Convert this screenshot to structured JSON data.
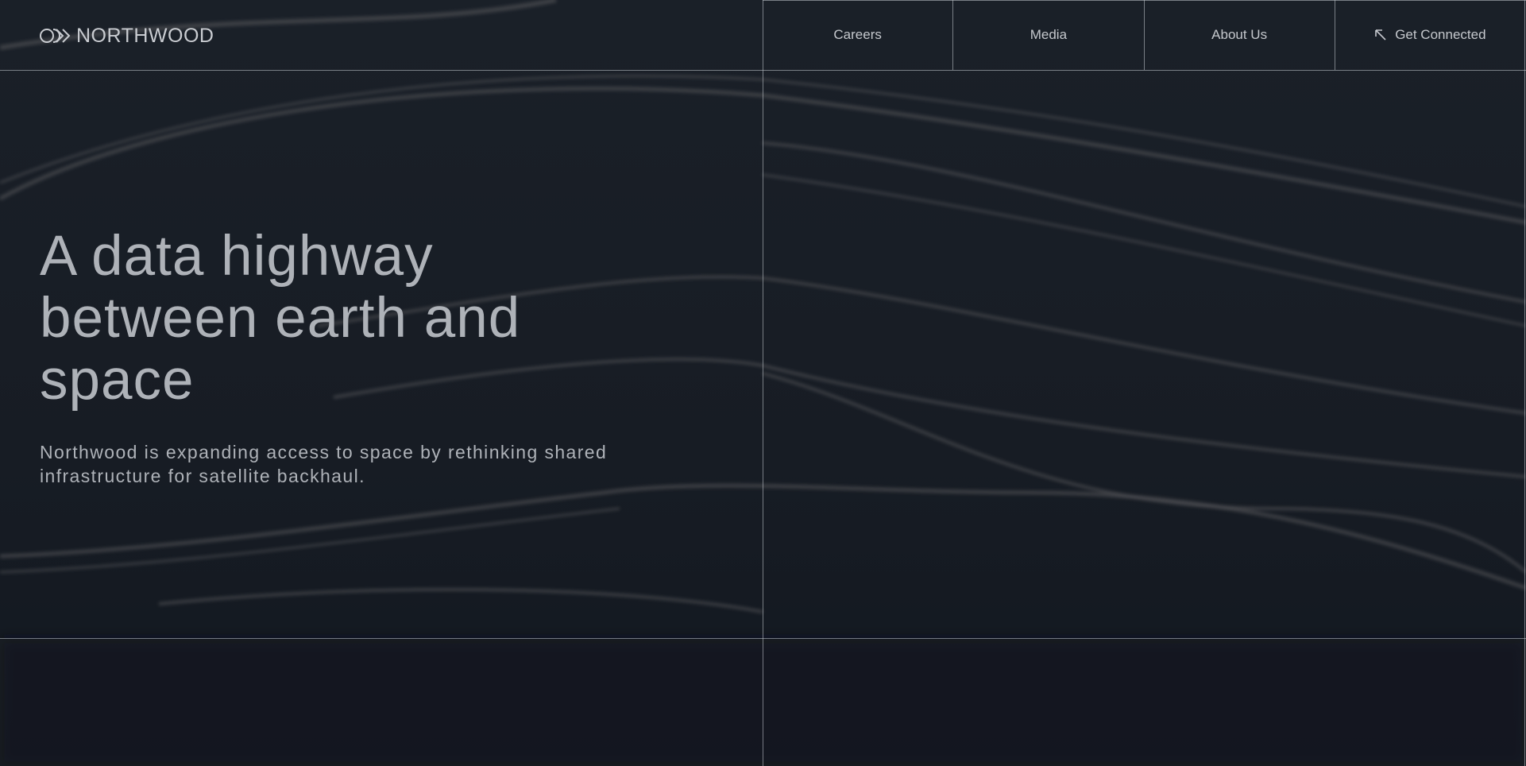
{
  "brand": {
    "name": "NORTHWOOD"
  },
  "nav": {
    "items": [
      {
        "label": "Careers"
      },
      {
        "label": "Media"
      },
      {
        "label": "About Us"
      },
      {
        "label": "Get Connected",
        "icon": "arrow-up-left-icon"
      }
    ]
  },
  "hero": {
    "title": "A data highway between earth and space",
    "subtitle": "Northwood is expanding access to space by rethinking shared infrastructure for satellite backhaul."
  },
  "colors": {
    "background": "#141a22",
    "text": "#aeb2b8",
    "lines": "#c8cdd4"
  }
}
